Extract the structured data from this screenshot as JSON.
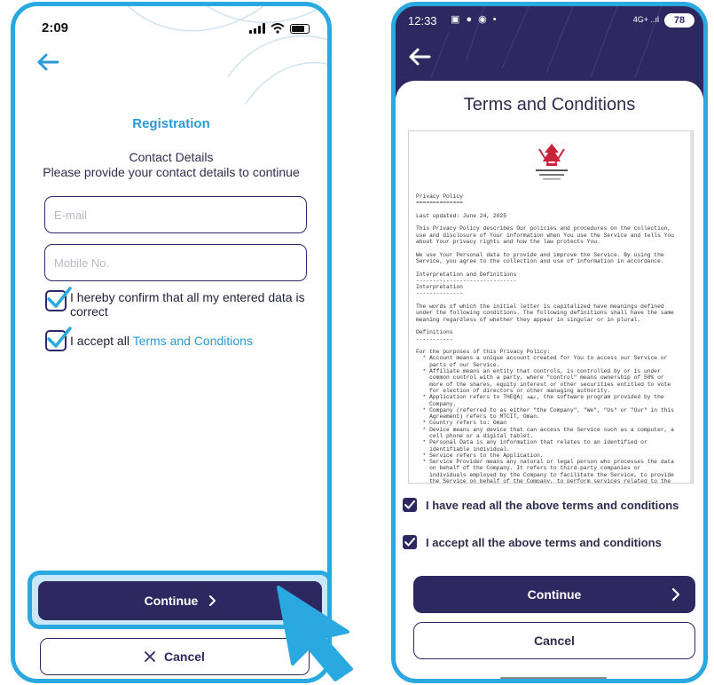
{
  "left_screen": {
    "status": {
      "time": "2:09"
    },
    "title": "Registration",
    "contact_title": "Contact Details",
    "contact_subtitle": "Please provide your contact details to continue",
    "fields": {
      "email": {
        "placeholder": "E-mail",
        "value": ""
      },
      "mobile": {
        "placeholder": "Mobile No.",
        "value": ""
      }
    },
    "checkboxes": {
      "confirm": {
        "label": "I hereby confirm that all my entered data is correct",
        "checked": true
      },
      "terms": {
        "prefix": "I accept all ",
        "link": "Terms and Conditions",
        "checked": true
      }
    },
    "buttons": {
      "continue": "Continue",
      "cancel": "Cancel"
    }
  },
  "right_screen": {
    "status": {
      "time": "12:33",
      "network": "4G+",
      "battery": "78"
    },
    "title": "Terms and Conditions",
    "document": {
      "text": "Privacy Policy\n==============\n\nLast updated: June 24, 2025\n\nThis Privacy Policy describes Our policies and procedures on the collection,\nuse and disclosure of Your information when You use the Service and tells You\nabout Your privacy rights and how the law protects You.\n\nWe use Your Personal data to provide and improve the Service. By using the\nService, you agree to the collection and use of information in accordance.\n\nInterpretation and Definitions\n------------------------------\nInterpretation\n--------------\n\nThe words of which the initial letter is capitalized have meanings defined\nunder the following conditions. The following definitions shall have the same\nmeaning regardless of whether they appear in singular or in plural.\n\nDefinitions\n-----------\n\nFor the purposes of this Privacy Policy:\n  * Account means a unique account created for You to access our Service or\n    parts of our Service.\n  * Affiliate means an entity that controls, is controlled by or is under\n    common control with a party, where \"control\" means ownership of 50% or\n    more of the shares, equity interest or other securities entitled to vote\n    for election of directors or other managing authority.\n  * Application refers to THEQA| ثقة, the software program provided by the\n    Company.\n  * Company (referred to as either \"the Company\", \"We\", \"Us\" or \"Our\" in this\n    Agreement) refers to MTCIT, Oman.\n  * Country refers to: Oman\n  * Device means any device that can access the Service such as a computer, a\n    cell phone or a digital tablet.\n  * Personal Data is any information that relates to an identified or\n    identifiable individual.\n  * Service refers to the Application.\n  * Service Provider means any natural or legal person who processes the data\n    on behalf of the Company. It refers to third-party companies or\n    individuals employed by the Company to facilitate the Service, to provide\n    the Service on behalf of the Company, to perform services related to the\n    Service or to assist the Company in analysing how the Service is used."
    },
    "checkboxes": {
      "read": {
        "label": "I have read all the above terms and conditions",
        "checked": true
      },
      "accept": {
        "label": "I accept all the above terms and conditions",
        "checked": true
      }
    },
    "buttons": {
      "continue": "Continue",
      "cancel": "Cancel"
    }
  },
  "colors": {
    "primary": "#2d2960",
    "accent": "#29a9e0",
    "link": "#2a9ad6"
  }
}
